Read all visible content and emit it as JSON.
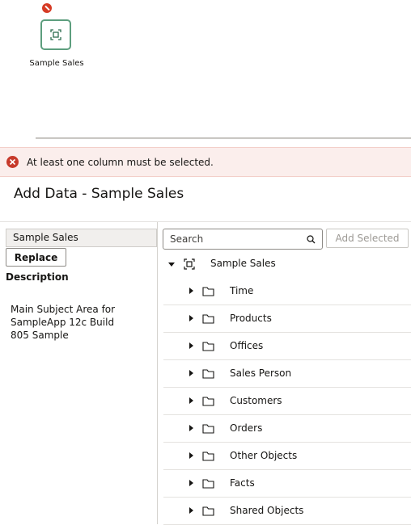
{
  "canvas": {
    "node_label": "Sample Sales",
    "node_icon": "subject-area-icon",
    "node_status_icon": "error-icon",
    "node_border_color": "#5d9e7e"
  },
  "error_banner": {
    "message": "At least one column must be selected.",
    "icon": "error-circle-icon",
    "color": "#c73a2b",
    "background": "#fbeeec"
  },
  "dialog": {
    "title": "Add Data - Sample Sales",
    "left_panel": {
      "subject_area": "Sample Sales",
      "replace_label": "Replace",
      "description_label": "Description",
      "description_text": "Main Subject Area for SampleApp 12c Build 805 Sample"
    },
    "search": {
      "placeholder": "Search",
      "icon": "search-icon"
    },
    "add_selected_label": "Add Selected",
    "tree": {
      "root": {
        "label": "Sample Sales",
        "icon": "subject-area-icon",
        "expanded": true
      },
      "items": [
        {
          "label": "Time",
          "icon": "folder-icon"
        },
        {
          "label": "Products",
          "icon": "folder-icon"
        },
        {
          "label": "Offices",
          "icon": "folder-icon"
        },
        {
          "label": "Sales Person",
          "icon": "folder-icon"
        },
        {
          "label": "Customers",
          "icon": "folder-icon"
        },
        {
          "label": "Orders",
          "icon": "folder-icon"
        },
        {
          "label": "Other Objects",
          "icon": "folder-icon"
        },
        {
          "label": "Facts",
          "icon": "folder-icon"
        },
        {
          "label": "Shared Objects",
          "icon": "folder-icon"
        }
      ]
    }
  }
}
